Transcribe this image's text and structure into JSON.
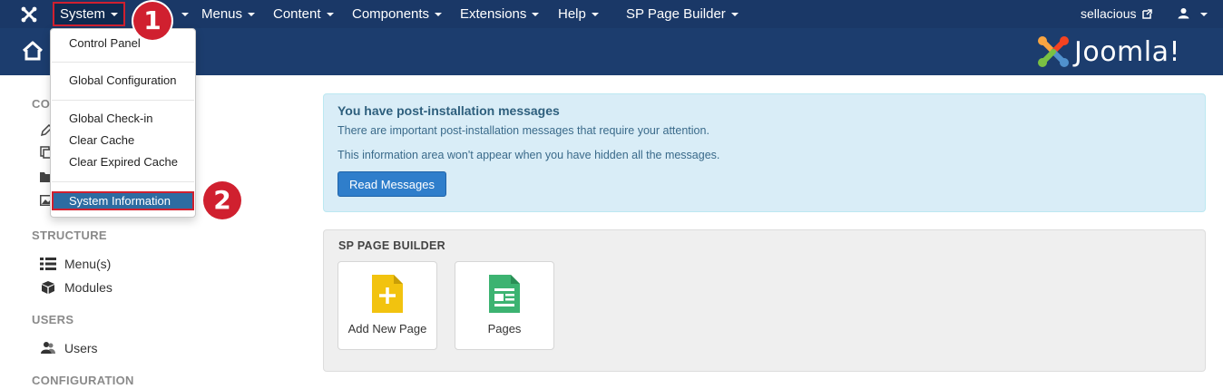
{
  "topnav": {
    "system": "System",
    "menus": "Menus",
    "content": "Content",
    "components": "Components",
    "extensions": "Extensions",
    "help": "Help",
    "sp_page_builder": "SP Page Builder",
    "user": "sellacious"
  },
  "dropdown": {
    "items": [
      "Control Panel",
      "Global Configuration",
      "Global Check-in",
      "Clear Cache",
      "Clear Expired Cache",
      "System Information"
    ]
  },
  "callouts": [
    "1",
    "2"
  ],
  "brand": {
    "name": "Joomla!"
  },
  "sidebar": {
    "content_heading_partial": "CO",
    "structure_heading": "STRUCTURE",
    "structure_items": [
      "Menu(s)",
      "Modules"
    ],
    "users_heading": "USERS",
    "users_items": [
      "Users"
    ],
    "configuration_heading": "CONFIGURATION"
  },
  "alert": {
    "title": "You have post-installation messages",
    "line1": "There are important post-installation messages that require your attention.",
    "line2": "This information area won't appear when you have hidden all the messages.",
    "button": "Read Messages"
  },
  "sppb": {
    "title": "SP PAGE BUILDER",
    "tiles": [
      "Add New Page",
      "Pages"
    ]
  },
  "colors": {
    "nav_bg": "#1a3867",
    "header_bg": "#1c3d6e",
    "highlight_red": "#d0202f",
    "active_blue": "#2d6ca2",
    "alert_bg": "#d9edf7",
    "button_blue": "#2f7ecb"
  }
}
